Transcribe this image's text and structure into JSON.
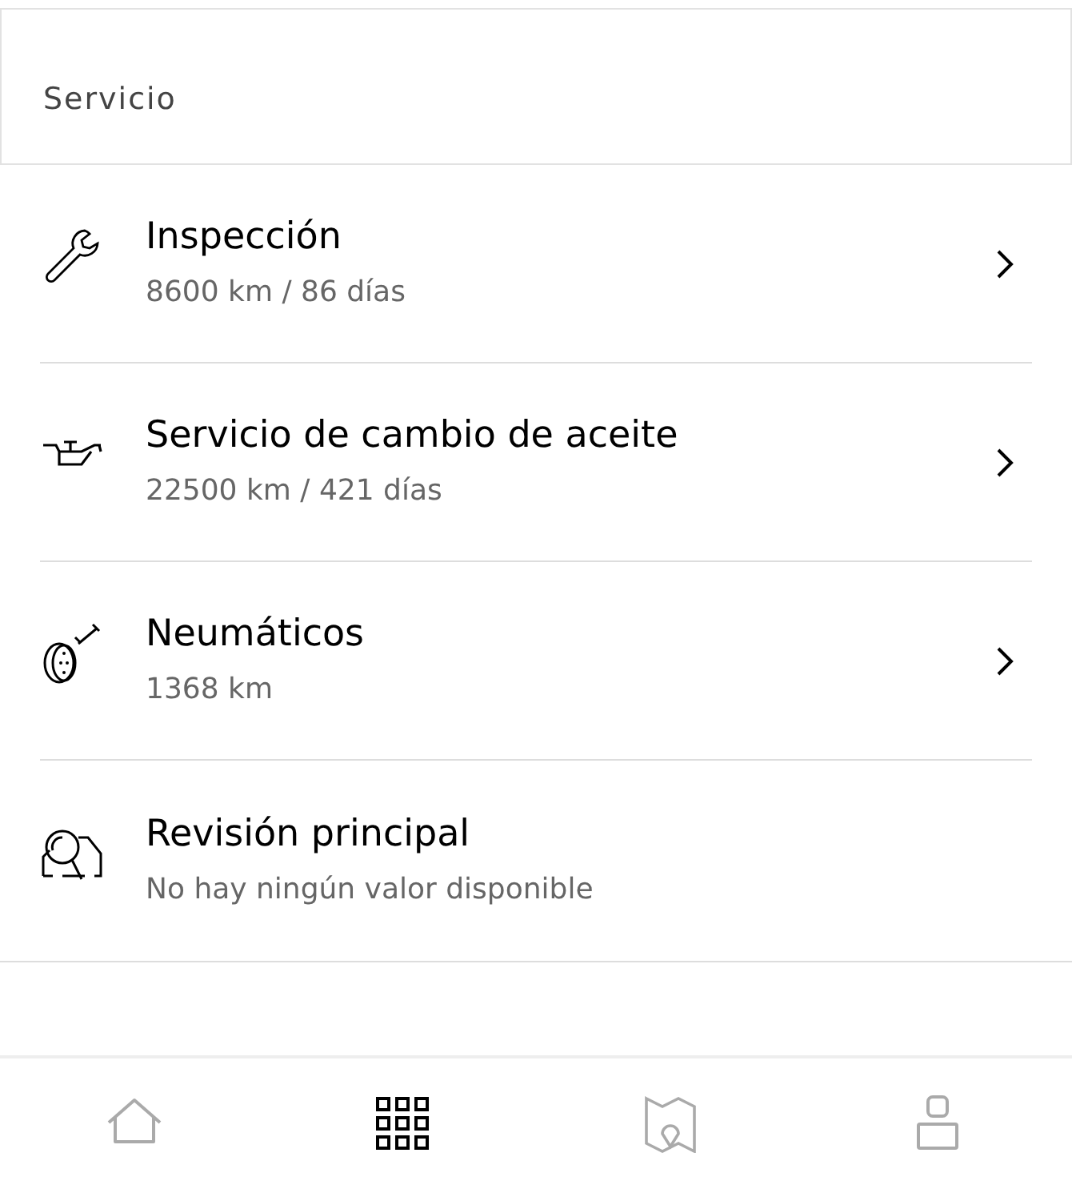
{
  "header": {
    "title": "Servicio"
  },
  "items": [
    {
      "kind": "wrench",
      "title": "Inspección",
      "detail": "8600 km / 86 días",
      "has_chevron": true
    },
    {
      "kind": "oilcan",
      "title": "Servicio de cambio de aceite",
      "detail": "22500 km / 421 días",
      "has_chevron": true
    },
    {
      "kind": "tyre",
      "title": "Neumáticos",
      "detail": "1368 km",
      "has_chevron": true
    },
    {
      "kind": "carsearch",
      "title": "Revisión principal",
      "detail": "No hay ningún valor disponible",
      "has_chevron": false
    }
  ],
  "bottom_nav": [
    {
      "kind": "home",
      "selected": false
    },
    {
      "kind": "grid",
      "selected": true
    },
    {
      "kind": "map",
      "selected": false
    },
    {
      "kind": "profile",
      "selected": false
    }
  ]
}
